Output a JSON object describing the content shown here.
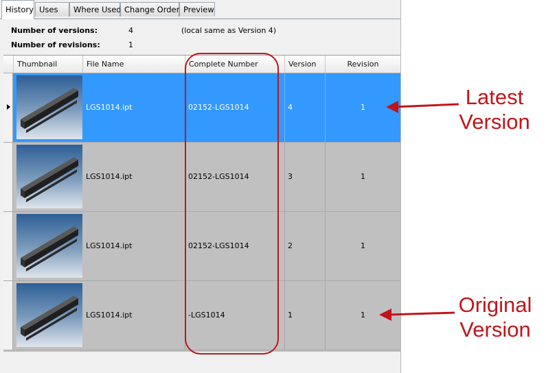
{
  "tabs": [
    {
      "label": "History",
      "active": true
    },
    {
      "label": "Uses",
      "active": false
    },
    {
      "label": "Where Used",
      "active": false
    },
    {
      "label": "Change Order",
      "active": false
    },
    {
      "label": "Preview",
      "active": false
    }
  ],
  "summary": {
    "versions_label": "Number of versions:",
    "versions_value": "4",
    "versions_note": "(local same as Version 4)",
    "revisions_label": "Number of revisions:",
    "revisions_value": "1"
  },
  "table": {
    "columns": [
      "Thumbnail",
      "File Name",
      "Complete Number",
      "Version",
      "Revision"
    ],
    "rows": [
      {
        "file_name": "LGS1014.ipt",
        "complete_number": "02152-LGS1014",
        "version": "4",
        "revision": "1",
        "selected": true
      },
      {
        "file_name": "LGS1014.ipt",
        "complete_number": "02152-LGS1014",
        "version": "3",
        "revision": "1",
        "selected": false
      },
      {
        "file_name": "LGS1014.ipt",
        "complete_number": "02152-LGS1014",
        "version": "2",
        "revision": "1",
        "selected": false
      },
      {
        "file_name": "LGS1014.ipt",
        "complete_number": "-LGS1014",
        "version": "1",
        "revision": "1",
        "selected": false
      }
    ]
  },
  "annotations": {
    "latest_line1": "Latest",
    "latest_line2": "Version",
    "original_line1": "Original",
    "original_line2": "Version",
    "accent_color": "#c0151b"
  },
  "colors": {
    "selection": "#3399ff",
    "row_background": "#c0c0c0"
  }
}
